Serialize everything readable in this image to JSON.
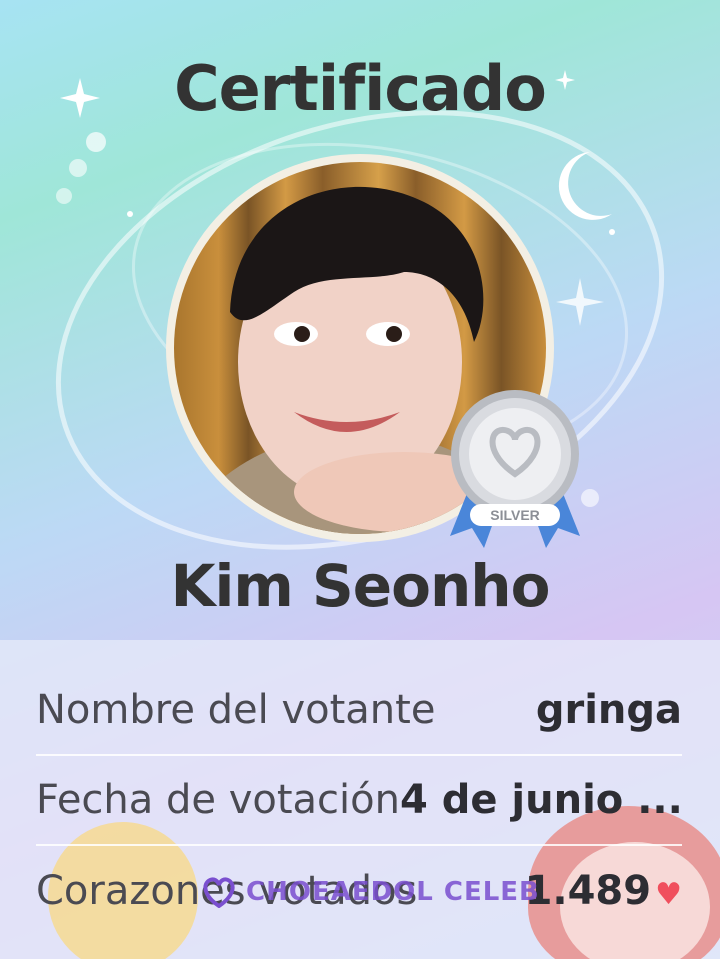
{
  "certificate": {
    "title": "Certificado",
    "celebrity_name": "Kim Seonho",
    "badge_label": "SILVER",
    "rows": [
      {
        "label": "Nombre del votante",
        "value": "gringa"
      },
      {
        "label": "Fecha de votación",
        "value": "4 de junio ..."
      },
      {
        "label": "Corazones votados",
        "value": "1.489"
      }
    ],
    "watermark": "CHOEAEDOL CELEB"
  },
  "icons": {
    "heart": "heart-icon",
    "badge": "silver-medal-icon",
    "moon": "crescent-moon-icon",
    "sparkle": "sparkle-icon"
  },
  "colors": {
    "text": "#333333",
    "heart": "#f04f5d",
    "badge_ribbon": "#4a86d9",
    "watermark": "#7a4fcf"
  }
}
